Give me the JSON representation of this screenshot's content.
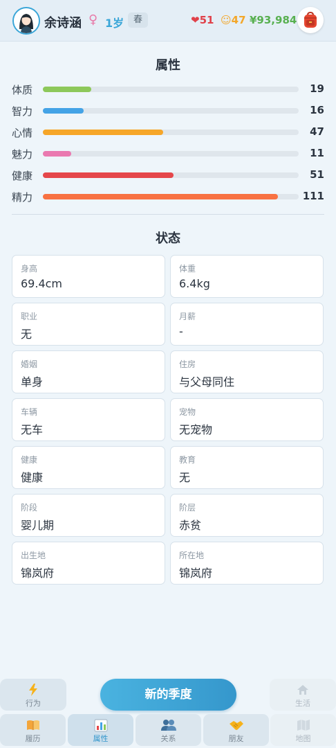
{
  "header": {
    "name": "余诗涵",
    "gender_symbol": "♀",
    "age": "1岁",
    "season": "春",
    "hp": "❤51",
    "joy": "☺47",
    "money": "¥93,984",
    "colors": {
      "hp": "#e0414a",
      "joy": "#f3a72a",
      "money": "#58b050",
      "accent": "#3aa6d8"
    }
  },
  "attributes": {
    "title": "属性",
    "items": [
      {
        "label": "体质",
        "value": "19",
        "fill": 0.19,
        "color": "#8dc85a"
      },
      {
        "label": "智力",
        "value": "16",
        "fill": 0.16,
        "color": "#44a3e6"
      },
      {
        "label": "心情",
        "value": "47",
        "fill": 0.47,
        "color": "#f6a629"
      },
      {
        "label": "魅力",
        "value": "11",
        "fill": 0.11,
        "color": "#ea79b0"
      },
      {
        "label": "健康",
        "value": "51",
        "fill": 0.51,
        "color": "#e5474a"
      },
      {
        "label": "精力",
        "value": "111",
        "fill": 0.92,
        "color": "#f87142"
      }
    ]
  },
  "status": {
    "title": "状态",
    "cards": [
      {
        "label": "身高",
        "value": "69.4cm"
      },
      {
        "label": "体重",
        "value": "6.4kg"
      },
      {
        "label": "职业",
        "value": "无"
      },
      {
        "label": "月薪",
        "value": "-"
      },
      {
        "label": "婚姻",
        "value": "单身"
      },
      {
        "label": "住房",
        "value": "与父母同住"
      },
      {
        "label": "车辆",
        "value": "无车"
      },
      {
        "label": "宠物",
        "value": "无宠物"
      },
      {
        "label": "健康",
        "value": "健康"
      },
      {
        "label": "教育",
        "value": "无"
      },
      {
        "label": "阶段",
        "value": "婴儿期"
      },
      {
        "label": "阶层",
        "value": "赤贫"
      },
      {
        "label": "出生地",
        "value": "锦岚府"
      },
      {
        "label": "所在地",
        "value": "锦岚府"
      }
    ]
  },
  "actions": {
    "action_label": "行为",
    "action_icon": "lightning-icon",
    "new_season_label": "新的季度",
    "life_label": "生活",
    "life_icon": "house-icon"
  },
  "nav": {
    "tabs": [
      {
        "label": "履历",
        "icon": "book-icon"
      },
      {
        "label": "属性",
        "icon": "bar-chart-icon",
        "active": true
      },
      {
        "label": "关系",
        "icon": "people-icon"
      },
      {
        "label": "朋友",
        "icon": "handshake-icon"
      },
      {
        "label": "地图",
        "icon": "map-icon",
        "disabled": true
      }
    ]
  }
}
